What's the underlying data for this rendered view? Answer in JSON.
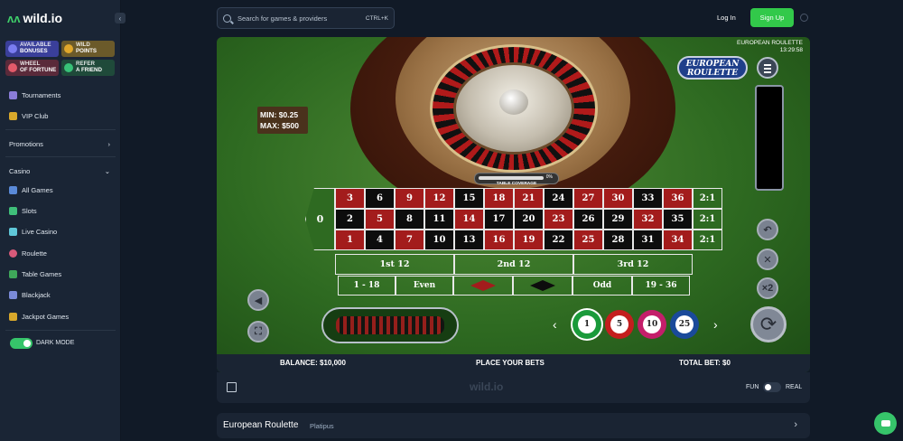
{
  "brand": {
    "name": "wild.io"
  },
  "sidebar": {
    "promos": [
      {
        "line1": "AVAILABLE",
        "line2": "BONUSES"
      },
      {
        "line1": "WILD",
        "line2": "POINTS"
      },
      {
        "line1": "WHEEL",
        "line2": "OF FORTUNE"
      },
      {
        "line1": "REFER",
        "line2": "A FRIEND"
      }
    ],
    "tournaments": "Tournaments",
    "vip": "VIP Club",
    "promotions": "Promotions",
    "casino": "Casino",
    "casino_items": [
      "All Games",
      "Slots",
      "Live Casino",
      "Roulette",
      "Table Games",
      "Blackjack",
      "Jackpot Games"
    ],
    "dark_mode": "DARK MODE"
  },
  "header": {
    "search_placeholder": "Search for games & providers",
    "search_shortcut": "CTRL+K",
    "login": "Log In",
    "signup": "Sign Up"
  },
  "game": {
    "name": "EUROPEAN ROULETTE",
    "time": "13:29:58",
    "logo_line1": "EUROPEAN",
    "logo_line2": "ROULETTE",
    "min": "MIN: $0.25",
    "max": "MAX: $500",
    "coverage_pct": "0%",
    "coverage_label": "TABLE COVERAGE",
    "zero": "0",
    "rows": [
      [
        "3",
        "6",
        "9",
        "12",
        "15",
        "18",
        "21",
        "24",
        "27",
        "30",
        "33",
        "36"
      ],
      [
        "2",
        "5",
        "8",
        "11",
        "14",
        "17",
        "20",
        "23",
        "26",
        "29",
        "32",
        "35"
      ],
      [
        "1",
        "4",
        "7",
        "10",
        "13",
        "16",
        "19",
        "22",
        "25",
        "28",
        "31",
        "34"
      ]
    ],
    "column_bets": [
      "2:1",
      "2:1",
      "2:1"
    ],
    "dozens": [
      "1st 12",
      "2nd 12",
      "3rd 12"
    ],
    "outside": {
      "low": "1 - 18",
      "even": "Even",
      "odd": "Odd",
      "high": "19 - 36"
    },
    "chips": [
      "1",
      "5",
      "10",
      "25"
    ],
    "balance": "BALANCE: $10,000",
    "prompt": "PLACE YOUR BETS",
    "total_bet": "TOTAL BET: $0",
    "buttons": {
      "undo": "↶",
      "clear": "✕",
      "double": "×2",
      "spin": "⟳"
    }
  },
  "footer": {
    "fun": "FUN",
    "real": "REAL",
    "logo": "wild.io"
  },
  "info": {
    "title": "European Roulette",
    "provider": "Platipus"
  },
  "colors": {
    "accent": "#32c94a",
    "red": "#a31c1c",
    "felt": "#2e6a21"
  }
}
